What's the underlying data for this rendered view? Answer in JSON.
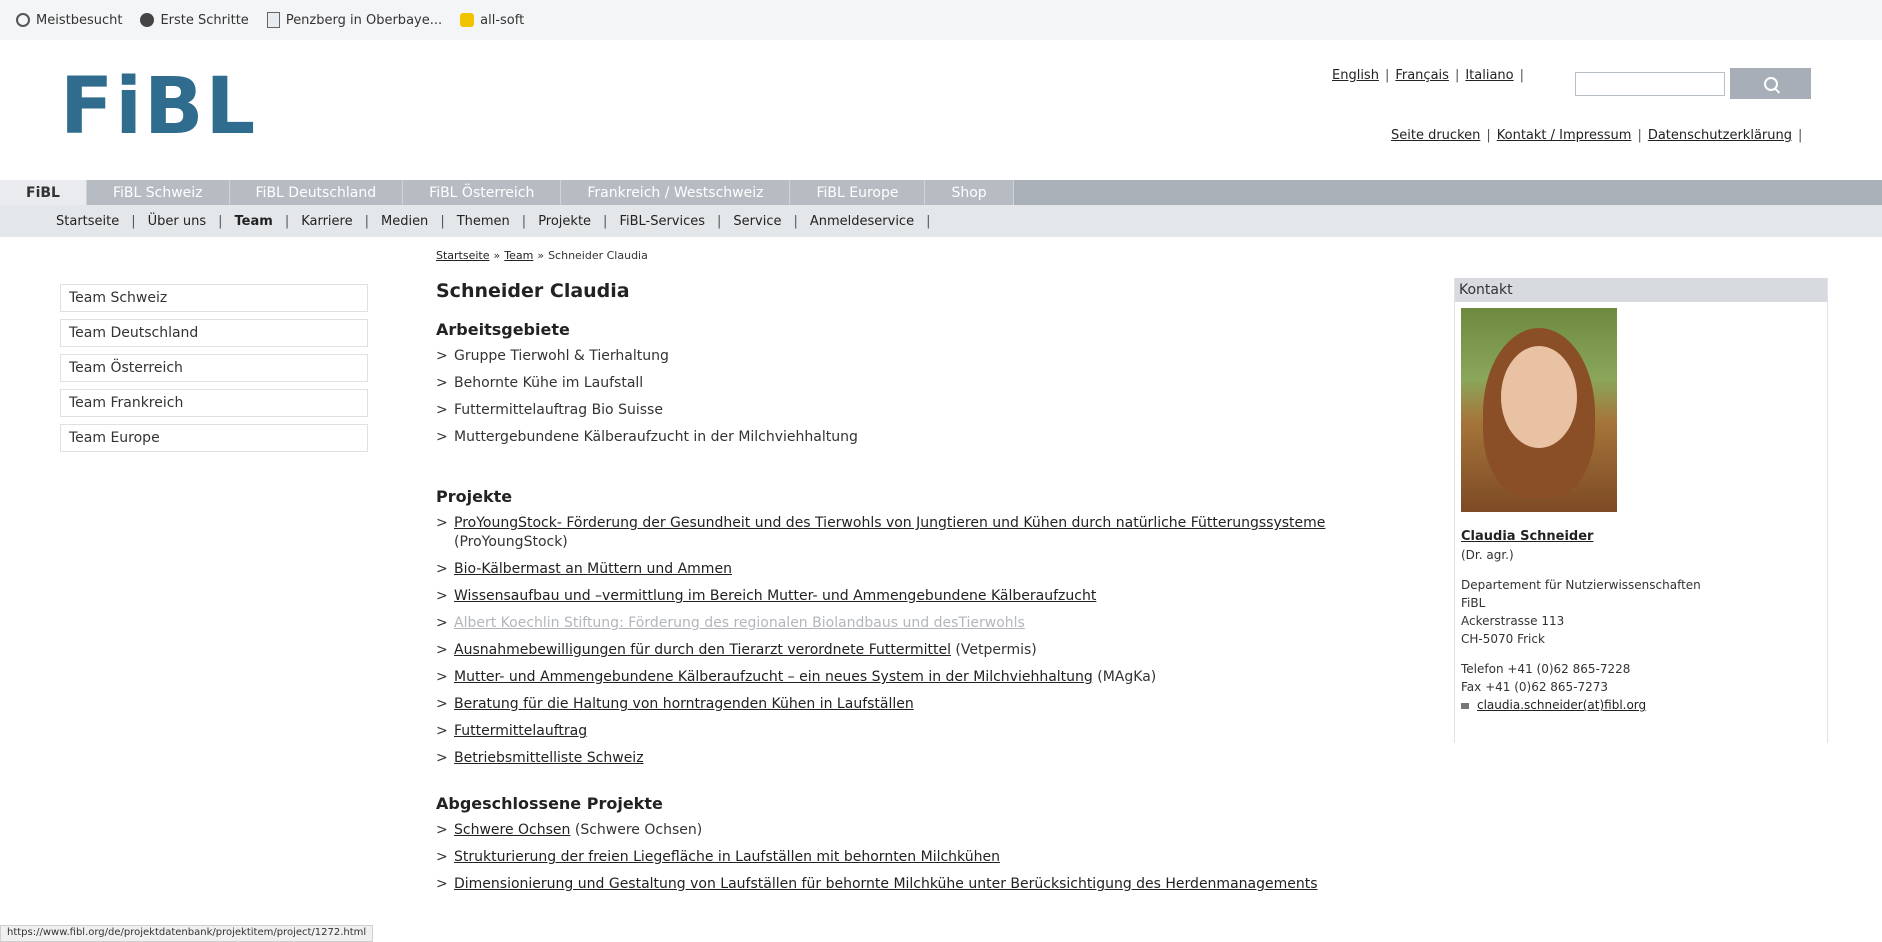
{
  "bookmarks": [
    {
      "label": "Meistbesucht",
      "icon": "gear-icon"
    },
    {
      "label": "Erste Schritte",
      "icon": "globe-icon"
    },
    {
      "label": "Penzberg in Oberbaye...",
      "icon": "document-icon"
    },
    {
      "label": "all-soft",
      "icon": "star-icon"
    }
  ],
  "header": {
    "logo": "FiBL",
    "languages": [
      "English",
      "Français",
      "Italiano"
    ],
    "search_placeholder": "",
    "utility_links": [
      "Seite drucken",
      "Kontakt / Impressum",
      "Datenschutzerklärung"
    ]
  },
  "main_nav": {
    "tabs": [
      "FiBL",
      "FiBL Schweiz",
      "FiBL Deutschland",
      "FiBL Österreich",
      "Frankreich / Westschweiz",
      "FiBL Europe",
      "Shop"
    ],
    "active": "FiBL"
  },
  "sub_nav": {
    "items": [
      "Startseite",
      "Über uns",
      "Team",
      "Karriere",
      "Medien",
      "Themen",
      "Projekte",
      "FiBL-Services",
      "Service",
      "Anmeldeservice"
    ],
    "active": "Team"
  },
  "breadcrumb": [
    "Startseite",
    "Team",
    "Schneider Claudia"
  ],
  "left_sidebar": [
    "Team Schweiz",
    "Team Deutschland",
    "Team Österreich",
    "Team Frankreich",
    "Team Europe"
  ],
  "content": {
    "name": "Schneider Claudia",
    "arbeitsgebiete_title": "Arbeitsgebiete",
    "arbeitsgebiete": [
      "Gruppe Tierwohl & Tierhaltung",
      "Behornte Kühe im Laufstall",
      "Futtermittelauftrag Bio Suisse",
      "Muttergebundene Kälberaufzucht in der Milchviehhaltung"
    ],
    "projekte_title": "Projekte",
    "projekte": [
      {
        "link": "ProYoungStock- Förderung der Gesundheit und des Tierwohls von Jungtieren und Kühen durch natürliche Fütterungssysteme",
        "suffix": "(ProYoungStock)"
      },
      {
        "link": "Bio-Kälbermast an Müttern und Ammen",
        "suffix": ""
      },
      {
        "link": "Wissensaufbau und –vermittlung im Bereich Mutter- und Ammengebundene Kälberaufzucht",
        "suffix": ""
      },
      {
        "link": "Albert Koechlin Stiftung: Förderung des regionalen Biolandbaus und desTierwohls",
        "suffix": "",
        "dim": true
      },
      {
        "link": "Ausnahmebewilligungen für durch den Tierarzt verordnete Futtermittel",
        "suffix": "(Vetpermis)"
      },
      {
        "link": "Mutter- und Ammengebundene Kälberaufzucht – ein neues System in der Milchviehhaltung",
        "suffix": "(MAgKa)"
      },
      {
        "link": "Beratung für die Haltung von horntragenden Kühen in Laufställen",
        "suffix": ""
      },
      {
        "link": "Futtermittelauftrag",
        "suffix": ""
      },
      {
        "link": "Betriebsmittelliste Schweiz",
        "suffix": ""
      }
    ],
    "abgeschlossen_title": "Abgeschlossene Projekte",
    "abgeschlossen": [
      {
        "link": "Schwere Ochsen",
        "suffix": "(Schwere Ochsen)"
      },
      {
        "link": "Strukturierung der freien Liegefläche in Laufställen mit behornten Milchkühen",
        "suffix": ""
      },
      {
        "link": "Dimensionierung und Gestaltung von Laufställen für behornte Milchkühe unter Berücksichtigung des Herdenmanagements",
        "suffix": ""
      }
    ]
  },
  "contact": {
    "title": "Kontakt",
    "name": "Claudia Schneider",
    "degree": "(Dr. agr.)",
    "department": "Departement für Nutzierwissenschaften",
    "org": "FiBL",
    "street": "Ackerstrasse 113",
    "city": "CH-5070 Frick",
    "phone": "Telefon +41 (0)62 865-7228",
    "fax": "Fax +41 (0)62 865-7273",
    "email": "claudia.schneider(at)fibl.org"
  },
  "status_url": "https://www.fibl.org/de/projektdatenbank/projektitem/project/1272.html"
}
